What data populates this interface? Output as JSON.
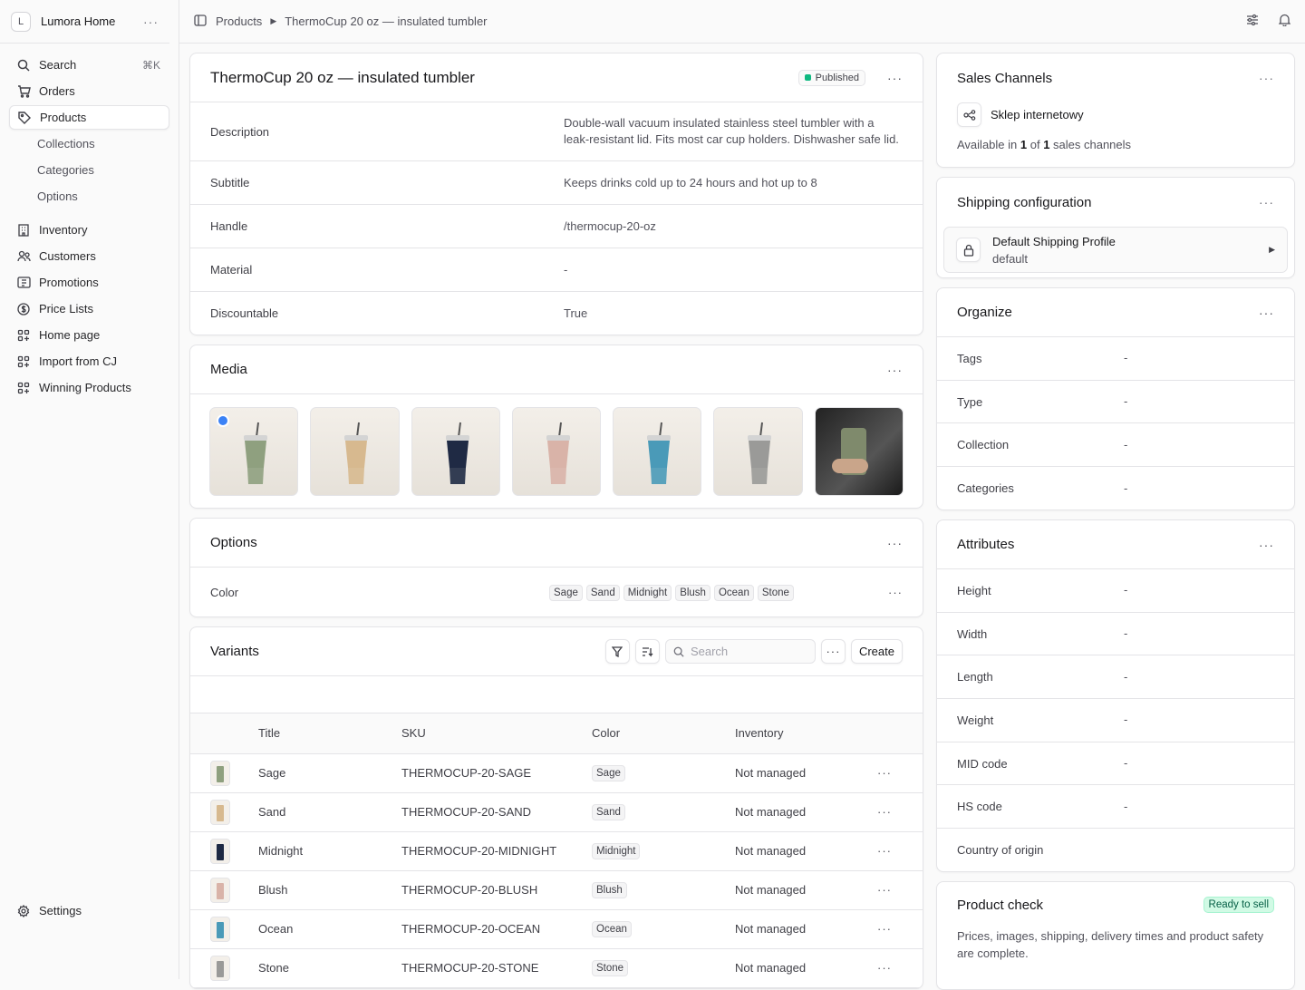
{
  "sidebar": {
    "store": {
      "initial": "L",
      "name": "Lumora Home"
    },
    "nav": [
      {
        "label": "Search",
        "kbd": "⌘K"
      },
      {
        "label": "Orders"
      },
      {
        "label": "Products"
      }
    ],
    "sub": [
      "Collections",
      "Categories",
      "Options"
    ],
    "extra": [
      "Inventory",
      "Customers",
      "Promotions",
      "Price Lists",
      "Home page",
      "Import from CJ",
      "Winning Products"
    ],
    "settings": "Settings"
  },
  "topbar": {
    "crumbs": [
      "Products",
      "ThermoCup 20 oz — insulated tumbler"
    ]
  },
  "product": {
    "title": "ThermoCup 20 oz — insulated tumbler",
    "status": "Published",
    "fields": [
      {
        "k": "Description",
        "v": "Double-wall vacuum insulated stainless steel tumbler with a leak-resistant lid. Fits most car cup holders. Dishwasher safe lid."
      },
      {
        "k": "Subtitle",
        "v": "Keeps drinks cold up to 24 hours and hot up to 8"
      },
      {
        "k": "Handle",
        "v": "/thermocup-20-oz"
      },
      {
        "k": "Material",
        "v": "-"
      },
      {
        "k": "Discountable",
        "v": "True"
      }
    ]
  },
  "media": {
    "title": "Media",
    "colors": [
      "#8fa07f",
      "#d7b98f",
      "#1f2a44",
      "#d9b3a8",
      "#4a9ab8",
      "#9a9a98"
    ],
    "last": "#7f8a6c"
  },
  "options": {
    "title": "Options",
    "name": "Color",
    "values": [
      "Sage",
      "Sand",
      "Midnight",
      "Blush",
      "Ocean",
      "Stone"
    ]
  },
  "variants": {
    "title": "Variants",
    "search_placeholder": "Search",
    "create": "Create",
    "headers": [
      "Title",
      "SKU",
      "Color",
      "Inventory"
    ],
    "rows": [
      {
        "t": "Sage",
        "sku": "THERMOCUP-20-SAGE",
        "c": "Sage",
        "inv": "Not managed",
        "col": "#8fa07f"
      },
      {
        "t": "Sand",
        "sku": "THERMOCUP-20-SAND",
        "c": "Sand",
        "inv": "Not managed",
        "col": "#d7b98f"
      },
      {
        "t": "Midnight",
        "sku": "THERMOCUP-20-MIDNIGHT",
        "c": "Midnight",
        "inv": "Not managed",
        "col": "#1f2a44"
      },
      {
        "t": "Blush",
        "sku": "THERMOCUP-20-BLUSH",
        "c": "Blush",
        "inv": "Not managed",
        "col": "#d9b3a8"
      },
      {
        "t": "Ocean",
        "sku": "THERMOCUP-20-OCEAN",
        "c": "Ocean",
        "inv": "Not managed",
        "col": "#4a9ab8"
      },
      {
        "t": "Stone",
        "sku": "THERMOCUP-20-STONE",
        "c": "Stone",
        "inv": "Not managed",
        "col": "#9a9a98"
      }
    ]
  },
  "sales": {
    "title": "Sales Channels",
    "channel": "Sklep internetowy",
    "avail_pre": "Available in ",
    "n": "1",
    "of": " of ",
    "total": "1",
    "avail_post": " sales channels"
  },
  "shipping": {
    "title": "Shipping configuration",
    "profile": "Default Shipping Profile",
    "sub": "default"
  },
  "organize": {
    "title": "Organize",
    "fields": [
      {
        "k": "Tags",
        "v": "-"
      },
      {
        "k": "Type",
        "v": "-"
      },
      {
        "k": "Collection",
        "v": "-"
      },
      {
        "k": "Categories",
        "v": "-"
      }
    ]
  },
  "attributes": {
    "title": "Attributes",
    "fields": [
      {
        "k": "Height",
        "v": "-"
      },
      {
        "k": "Width",
        "v": "-"
      },
      {
        "k": "Length",
        "v": "-"
      },
      {
        "k": "Weight",
        "v": "-"
      },
      {
        "k": "MID code",
        "v": "-"
      },
      {
        "k": "HS code",
        "v": "-"
      },
      {
        "k": "Country of origin",
        "v": ""
      }
    ]
  },
  "check": {
    "title": "Product check",
    "badge": "Ready to sell",
    "text": "Prices, images, shipping, delivery times and product safety are complete."
  }
}
